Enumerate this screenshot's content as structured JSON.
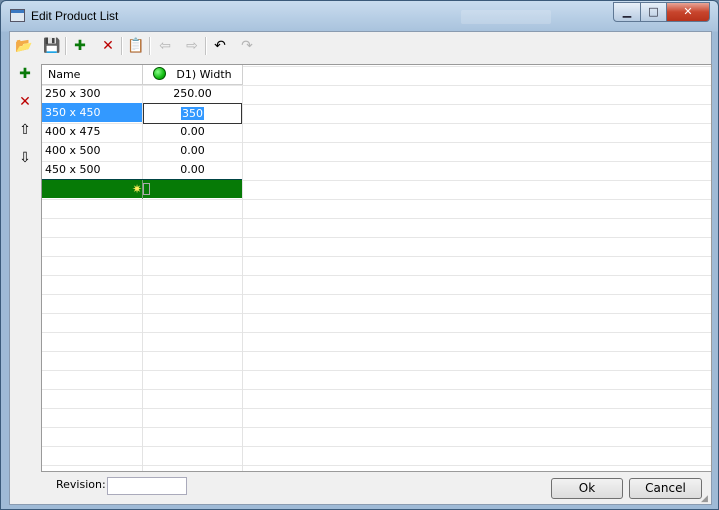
{
  "window": {
    "title": "Edit Product List",
    "min": "▁",
    "max": "□",
    "close": "✕"
  },
  "toolbar": [
    {
      "name": "open-folder-icon",
      "glyph": "📂",
      "enabled": true
    },
    {
      "name": "save-icon",
      "glyph": "💾",
      "enabled": true
    },
    {
      "name": "add-row-icon",
      "glyph": "✚",
      "enabled": true
    },
    {
      "name": "delete-icon",
      "glyph": "✕",
      "enabled": true
    },
    {
      "name": "properties-icon",
      "glyph": "📋",
      "enabled": true
    },
    {
      "name": "arrow-left-icon",
      "glyph": "⇦",
      "enabled": false
    },
    {
      "name": "arrow-right-icon",
      "glyph": "⇨",
      "enabled": false
    },
    {
      "name": "undo-icon",
      "glyph": "↶",
      "enabled": true
    },
    {
      "name": "redo-icon",
      "glyph": "↷",
      "enabled": false
    }
  ],
  "sidebar": [
    {
      "name": "add-row-icon",
      "glyph": "✚"
    },
    {
      "name": "delete-row-icon",
      "glyph": "✕"
    },
    {
      "name": "move-up-icon",
      "glyph": "⇧"
    },
    {
      "name": "move-down-icon",
      "glyph": "⇩"
    }
  ],
  "grid": {
    "headers": [
      "Name",
      "D1) Width"
    ],
    "rows": [
      {
        "name": "250 x 300",
        "value": "250.00"
      },
      {
        "name": "350 x 450",
        "value": "350"
      },
      {
        "name": "400 x 475",
        "value": "0.00"
      },
      {
        "name": "400 x 500",
        "value": "0.00"
      },
      {
        "name": "450 x 500",
        "value": "0.00"
      }
    ],
    "new_row_icon": "✷"
  },
  "footer": {
    "revision_label": "Revision:",
    "revision_value": "",
    "ok": "Ok",
    "cancel": "Cancel"
  },
  "colors": {
    "selection": "#3399ff",
    "new_row": "#067a06",
    "status_dot": "#22bb22"
  }
}
